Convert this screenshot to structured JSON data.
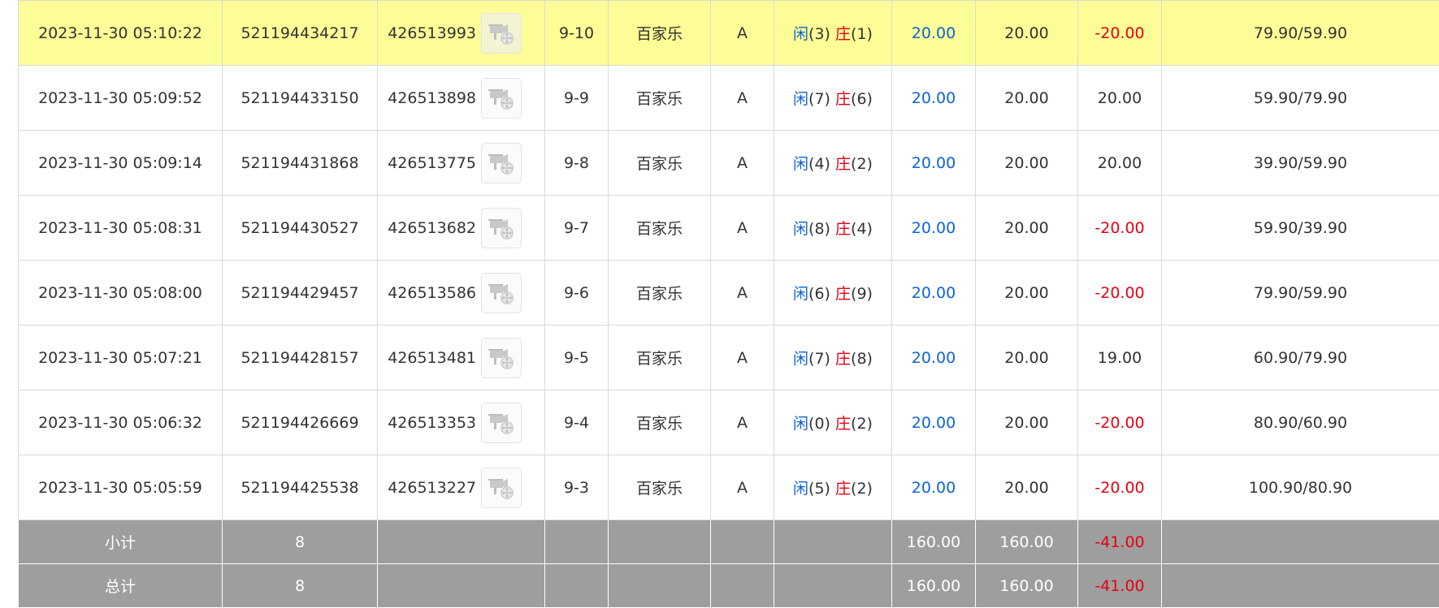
{
  "rows": [
    {
      "time": "2023-11-30 05:10:22",
      "order": "521194434217",
      "round": "426513993",
      "shoe": "9-10",
      "game": "百家乐",
      "table": "A",
      "player_label": "闲",
      "player_value": "(3)",
      "banker_label": "庄",
      "banker_value": "(1)",
      "bet": "20.00",
      "valid": "20.00",
      "win": "-20.00",
      "win_status": "negative",
      "balance": "79.90/59.90",
      "icon": "video-replay-icon",
      "highlight": true
    },
    {
      "time": "2023-11-30 05:09:52",
      "order": "521194433150",
      "round": "426513898",
      "shoe": "9-9",
      "game": "百家乐",
      "table": "A",
      "player_label": "闲",
      "player_value": "(7)",
      "banker_label": "庄",
      "banker_value": "(6)",
      "bet": "20.00",
      "valid": "20.00",
      "win": "20.00",
      "win_status": "positive",
      "balance": "59.90/79.90",
      "icon": "video-replay-icon",
      "highlight": false
    },
    {
      "time": "2023-11-30 05:09:14",
      "order": "521194431868",
      "round": "426513775",
      "shoe": "9-8",
      "game": "百家乐",
      "table": "A",
      "player_label": "闲",
      "player_value": "(4)",
      "banker_label": "庄",
      "banker_value": "(2)",
      "bet": "20.00",
      "valid": "20.00",
      "win": "20.00",
      "win_status": "positive",
      "balance": "39.90/59.90",
      "icon": "video-replay-icon",
      "highlight": false
    },
    {
      "time": "2023-11-30 05:08:31",
      "order": "521194430527",
      "round": "426513682",
      "shoe": "9-7",
      "game": "百家乐",
      "table": "A",
      "player_label": "闲",
      "player_value": "(8)",
      "banker_label": "庄",
      "banker_value": "(4)",
      "bet": "20.00",
      "valid": "20.00",
      "win": "-20.00",
      "win_status": "negative",
      "balance": "59.90/39.90",
      "icon": "video-replay-icon",
      "highlight": false
    },
    {
      "time": "2023-11-30 05:08:00",
      "order": "521194429457",
      "round": "426513586",
      "shoe": "9-6",
      "game": "百家乐",
      "table": "A",
      "player_label": "闲",
      "player_value": "(6)",
      "banker_label": "庄",
      "banker_value": "(9)",
      "bet": "20.00",
      "valid": "20.00",
      "win": "-20.00",
      "win_status": "negative",
      "balance": "79.90/59.90",
      "icon": "video-replay-icon",
      "highlight": false
    },
    {
      "time": "2023-11-30 05:07:21",
      "order": "521194428157",
      "round": "426513481",
      "shoe": "9-5",
      "game": "百家乐",
      "table": "A",
      "player_label": "闲",
      "player_value": "(7)",
      "banker_label": "庄",
      "banker_value": "(8)",
      "bet": "20.00",
      "valid": "20.00",
      "win": "19.00",
      "win_status": "positive",
      "balance": "60.90/79.90",
      "icon": "video-replay-icon",
      "highlight": false
    },
    {
      "time": "2023-11-30 05:06:32",
      "order": "521194426669",
      "round": "426513353",
      "shoe": "9-4",
      "game": "百家乐",
      "table": "A",
      "player_label": "闲",
      "player_value": "(0)",
      "banker_label": "庄",
      "banker_value": "(2)",
      "bet": "20.00",
      "valid": "20.00",
      "win": "-20.00",
      "win_status": "negative",
      "balance": "80.90/60.90",
      "icon": "video-replay-icon",
      "highlight": false
    },
    {
      "time": "2023-11-30 05:05:59",
      "order": "521194425538",
      "round": "426513227",
      "shoe": "9-3",
      "game": "百家乐",
      "table": "A",
      "player_label": "闲",
      "player_value": "(5)",
      "banker_label": "庄",
      "banker_value": "(2)",
      "bet": "20.00",
      "valid": "20.00",
      "win": "-20.00",
      "win_status": "negative",
      "balance": "100.90/80.90",
      "icon": "video-replay-icon",
      "highlight": false
    }
  ],
  "subtotal": {
    "label": "小计",
    "count": "8",
    "bet": "160.00",
    "valid": "160.00",
    "win": "-41.00"
  },
  "total": {
    "label": "总计",
    "count": "8",
    "bet": "160.00",
    "valid": "160.00",
    "win": "-41.00"
  },
  "colors": {
    "highlight_row": "#fdfd97",
    "total_row": "#9e9e9e",
    "player": "#0b64d6",
    "banker": "#e60012",
    "negative": "#e60012",
    "bet": "#0b64d6"
  }
}
